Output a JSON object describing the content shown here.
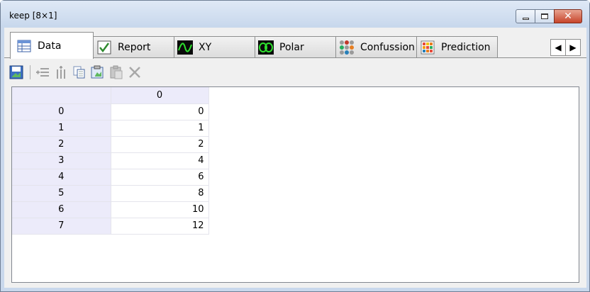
{
  "window": {
    "title": "keep [8×1]",
    "controls": [
      "minimize-icon",
      "maximize-icon",
      "close-icon"
    ]
  },
  "tabs": [
    {
      "label": "Data",
      "icon": "table-icon",
      "active": true
    },
    {
      "label": "Report",
      "icon": "checkbox-icon",
      "active": false
    },
    {
      "label": "XY",
      "icon": "sine-wave-icon",
      "active": false
    },
    {
      "label": "Polar",
      "icon": "polar-plot-icon",
      "active": false
    },
    {
      "label": "Confussion",
      "icon": "dot-matrix-icon",
      "active": false
    },
    {
      "label": "Prediction",
      "icon": "heatmap-grid-icon",
      "active": false
    }
  ],
  "toolbar": [
    "save-icon",
    "add-row-icon",
    "add-column-icon",
    "copy-icon",
    "paste-special-icon",
    "paste-icon",
    "delete-icon"
  ],
  "grid": {
    "column_headers": [
      "0"
    ],
    "rows": [
      {
        "index": "0",
        "values": [
          "0"
        ]
      },
      {
        "index": "1",
        "values": [
          "1"
        ]
      },
      {
        "index": "2",
        "values": [
          "2"
        ]
      },
      {
        "index": "3",
        "values": [
          "4"
        ]
      },
      {
        "index": "4",
        "values": [
          "6"
        ]
      },
      {
        "index": "5",
        "values": [
          "8"
        ]
      },
      {
        "index": "6",
        "values": [
          "10"
        ]
      },
      {
        "index": "7",
        "values": [
          "12"
        ]
      }
    ]
  },
  "colors": {
    "header_bg": "#ecebfa",
    "titlebar": "#c9d8ec",
    "close_button": "#c7442a"
  }
}
